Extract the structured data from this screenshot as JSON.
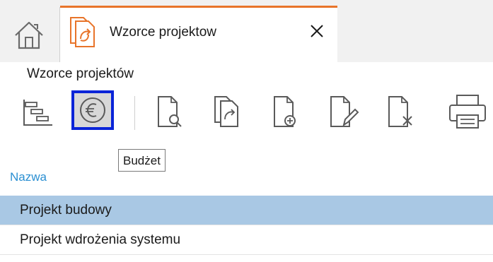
{
  "tab": {
    "title": "Wzorce projektow",
    "close_label": "×"
  },
  "page": {
    "title": "Wzorce projektów"
  },
  "toolbar": {
    "buttons": [
      {
        "icon": "tree-structure-icon"
      },
      {
        "icon": "euro-icon",
        "tooltip": "Budżet",
        "state": "focused"
      },
      {
        "icon": "document-preview-icon"
      },
      {
        "icon": "document-copy-icon"
      },
      {
        "icon": "document-add-icon"
      },
      {
        "icon": "document-edit-icon"
      },
      {
        "icon": "document-delete-icon"
      },
      {
        "icon": "printer-icon"
      }
    ],
    "tooltip_text": "Budżet"
  },
  "list": {
    "column_header": "Nazwa",
    "rows": [
      {
        "name": "Projekt budowy",
        "selected": true
      },
      {
        "name": "Projekt wdrożenia systemu",
        "selected": false
      }
    ]
  },
  "colors": {
    "accent_tab": "#e8742a",
    "focus_border": "#0a24d8",
    "selection": "#a9c8e4",
    "header_link": "#2a8fd2"
  }
}
